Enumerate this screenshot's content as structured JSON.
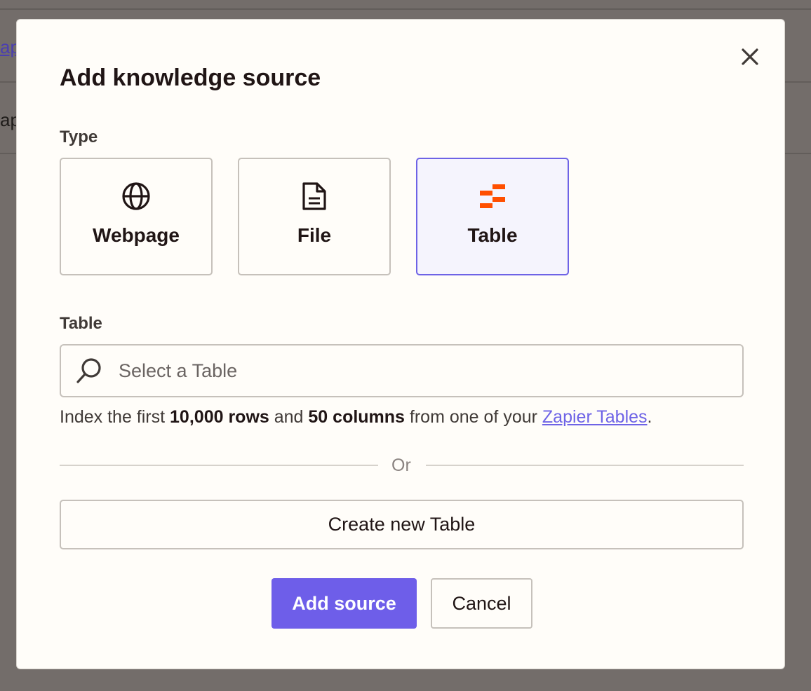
{
  "background": {
    "link_fragment": "ap",
    "text_fragment": "ap"
  },
  "modal": {
    "title": "Add knowledge source",
    "close_icon": "close-icon",
    "type_label": "Type",
    "types": [
      {
        "label": "Webpage",
        "icon": "globe-icon",
        "selected": false
      },
      {
        "label": "File",
        "icon": "document-icon",
        "selected": false
      },
      {
        "label": "Table",
        "icon": "zapier-tables-icon",
        "selected": true
      }
    ],
    "table_label": "Table",
    "search": {
      "placeholder": "Select a Table",
      "value": "",
      "icon": "search-icon"
    },
    "hint": {
      "prefix": "Index the first ",
      "rows": "10,000 rows",
      "middle": " and ",
      "columns": "50 columns",
      "suffix": " from one of your ",
      "link": "Zapier Tables",
      "end": "."
    },
    "divider_text": "Or",
    "create_button": "Create new Table",
    "add_button": "Add source",
    "cancel_button": "Cancel"
  },
  "colors": {
    "accent": "#6e5ee9",
    "table_icon": "#ff4f00",
    "overlay": "#736d6a",
    "modal_bg": "#fffdf9"
  }
}
